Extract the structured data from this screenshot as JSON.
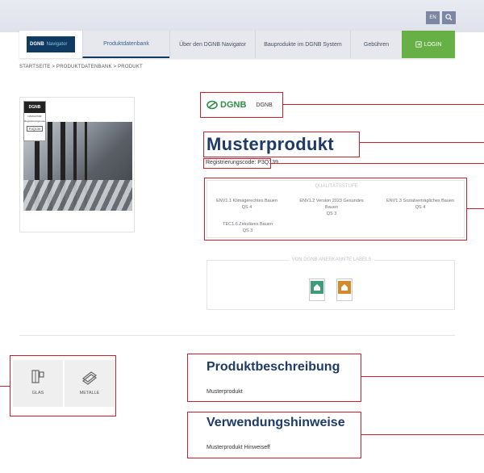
{
  "header": {
    "lang": "EN",
    "search_icon": "search-icon"
  },
  "nav": {
    "logo_brand": "DGNB",
    "logo_sub": "Navigator",
    "items": [
      {
        "label": "Produktdatenbank"
      },
      {
        "label": "Über den DGNB Navigator"
      },
      {
        "label": "Bauprodukte im DGNB System"
      },
      {
        "label": "Gebühren"
      }
    ],
    "login": "LOGIN"
  },
  "breadcrumb": "STARTSEITE  >  PRODUKTDATENBANK  >  PRODUKT",
  "product_badge": {
    "title": "DGNB",
    "subtitle": "NAVIGATOR",
    "line": "Registrierungscode",
    "code": "P3Q139"
  },
  "brand": {
    "logo_text": "DGNB",
    "label": "DGNB"
  },
  "product": {
    "title": "Musterprodukt",
    "reg_code": "Registrierungscode: P3Q139"
  },
  "quality": {
    "title": "QUALITÄTSSTUFE",
    "items": [
      {
        "name": "ENV1.1 Klimagerechtes Bauen",
        "level": "QS 4"
      },
      {
        "name": "ENV1.2 Version 2023 Gesundes Bauen",
        "level": "QS 3"
      },
      {
        "name": "ENV1.3 Sozialverträgliches Bauen",
        "level": "QS 4"
      },
      {
        "name": "TEC1.6 Zirkuläres Bauen",
        "level": "QS 3"
      }
    ]
  },
  "labels": {
    "title": "VON DGNB ANERKANNTE LABELS",
    "items": [
      {
        "color": "#3f9c7a"
      },
      {
        "color": "#d48a2a"
      }
    ]
  },
  "materials": [
    {
      "label": "GLAS",
      "icon": "window-icon"
    },
    {
      "label": "METALLE",
      "icon": "metal-sheets-icon"
    }
  ],
  "description": {
    "title": "Produktbeschreibung",
    "text": "Musterprodukt"
  },
  "usage": {
    "title": "Verwendungshinweise",
    "text": "Musterprodukt Hinweiseff"
  },
  "colors": {
    "navy": "#1d3b66",
    "green": "#66b046",
    "highlight": "#cc2030"
  }
}
